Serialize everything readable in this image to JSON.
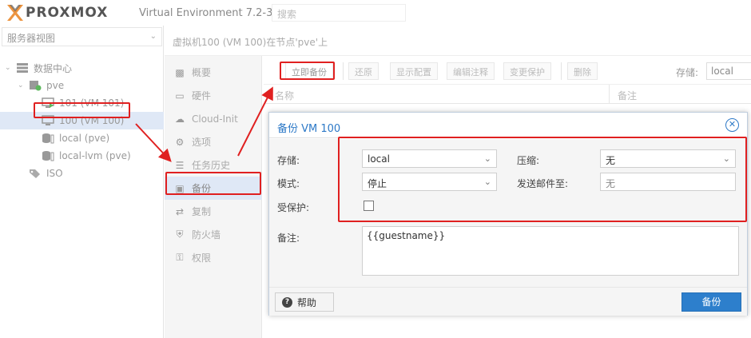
{
  "header": {
    "logo_text": "PROXMOX",
    "product": "Virtual Environment 7.2-3",
    "search_placeholder": "搜索"
  },
  "tree": {
    "view_select": "服务器视图",
    "items": [
      {
        "label": "数据中心",
        "icon": "datacenter-icon"
      },
      {
        "label": "pve",
        "icon": "node-icon"
      },
      {
        "label": "101 (VM 101)",
        "icon": "vm-running-icon"
      },
      {
        "label": "100 (VM 100)",
        "icon": "vm-stopped-icon"
      },
      {
        "label": "local (pve)",
        "icon": "storage-icon"
      },
      {
        "label": "local-lvm (pve)",
        "icon": "storage-icon"
      },
      {
        "label": "ISO",
        "icon": "tags-icon"
      }
    ]
  },
  "main": {
    "breadcrumb": "虚拟机100 (VM 100)在节点'pve'上",
    "nav": [
      {
        "label": "概要",
        "icon": "book-icon"
      },
      {
        "label": "硬件",
        "icon": "monitor-icon"
      },
      {
        "label": "Cloud-Init",
        "icon": "cloud-icon"
      },
      {
        "label": "选项",
        "icon": "gear-icon"
      },
      {
        "label": "任务历史",
        "icon": "list-icon"
      },
      {
        "label": "备份",
        "icon": "floppy-icon"
      },
      {
        "label": "复制",
        "icon": "retweet-icon"
      },
      {
        "label": "防火墙",
        "icon": "shield-icon"
      },
      {
        "label": "权限",
        "icon": "unlock-icon"
      }
    ],
    "toolbar": {
      "backup_now": "立即备份",
      "restore": "还原",
      "show_config": "显示配置",
      "edit_notes": "编辑注释",
      "change_protection": "变更保护",
      "delete": "删除",
      "storage_label": "存储:",
      "storage_value": "local"
    },
    "grid_headers": {
      "name": "名称",
      "notes": "备注"
    }
  },
  "dialog": {
    "title": "备份 VM 100",
    "storage_label": "存储:",
    "storage_value": "local",
    "compression_label": "压缩:",
    "compression_value": "无",
    "mode_label": "模式:",
    "mode_value": "停止",
    "send_mail_label": "发送邮件至:",
    "send_mail_placeholder": "无",
    "protected_label": "受保护:",
    "protected_checked": false,
    "notes_label": "备注:",
    "notes_value": "{{guestname}}",
    "help_button": "帮助",
    "backup_button": "备份"
  },
  "colors": {
    "accent": "#2d79c7",
    "primary_button": "#2d7fcc",
    "highlight": "#e02020",
    "selected_row": "#dfe8f6"
  }
}
